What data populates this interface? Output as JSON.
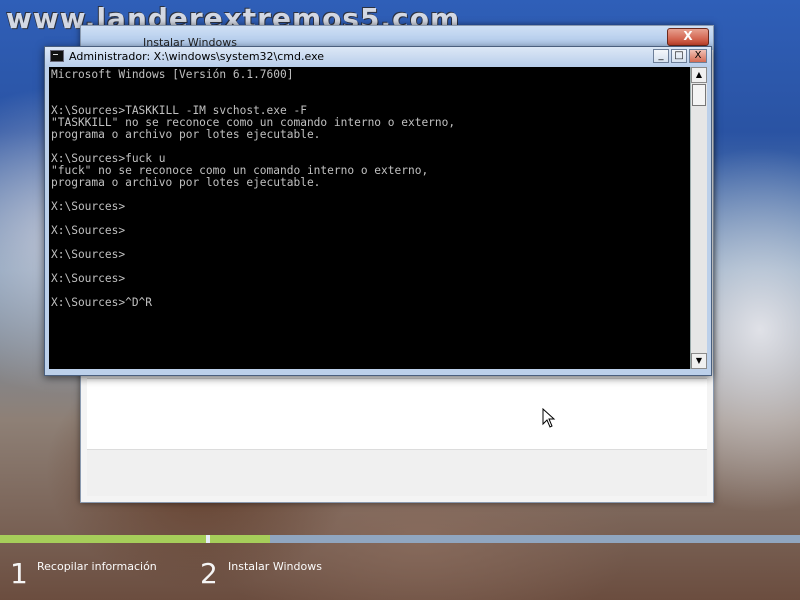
{
  "watermark": "www.landerextremos5.com",
  "installer": {
    "title": "Instalar Windows",
    "close_symbol": "X"
  },
  "cmd": {
    "title": "Administrador: X:\\windows\\system32\\cmd.exe",
    "icon": "console-icon",
    "controls": {
      "minimize": "_",
      "maximize": "□",
      "close": "X"
    },
    "console_text": "Microsoft Windows [Versión 6.1.7600]\n\n\nX:\\Sources>TASKKILL -IM svchost.exe -F\n\"TASKKILL\" no se reconoce como un comando interno o externo,\nprograma o archivo por lotes ejecutable.\n\nX:\\Sources>fuck u\n\"fuck\" no se reconoce como un comando interno o externo,\nprograma o archivo por lotes ejecutable.\n\nX:\\Sources>\n\nX:\\Sources>\n\nX:\\Sources>\n\nX:\\Sources>\n\nX:\\Sources>^D^R",
    "scroll_up": "▲",
    "scroll_down": "▼"
  },
  "steps": [
    {
      "number": "1",
      "label": "Recopilar información"
    },
    {
      "number": "2",
      "label": "Instalar Windows"
    }
  ],
  "colors": {
    "progress_done": "#a6ce5a",
    "progress_track": "#90a6c0",
    "console_text": "#c0c0c0",
    "console_bg": "#000000"
  }
}
